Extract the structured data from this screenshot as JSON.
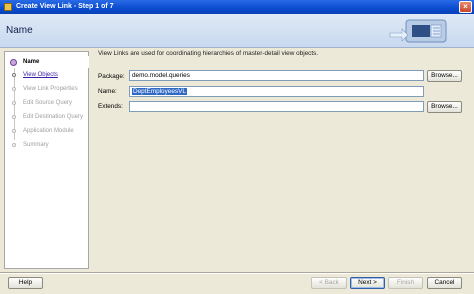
{
  "window": {
    "title": "Create View Link - Step 1 of 7",
    "close_label": "×"
  },
  "header": {
    "title": "Name"
  },
  "nav": {
    "items": [
      {
        "label": "Name",
        "state": "active"
      },
      {
        "label": "View Objects",
        "state": "link"
      },
      {
        "label": "View Link Properties",
        "state": "disabled"
      },
      {
        "label": "Edit Source Query",
        "state": "disabled"
      },
      {
        "label": "Edit Destination Query",
        "state": "disabled"
      },
      {
        "label": "Application Module",
        "state": "disabled"
      },
      {
        "label": "Summary",
        "state": "disabled"
      }
    ]
  },
  "main": {
    "description": "View Links are used for coordinating hierarchies of master-detail view objects.",
    "package_label": "Package:",
    "package_value": "demo.model.queries",
    "name_label": "Name:",
    "name_value": "DeptEmployeesVL",
    "extends_label": "Extends:",
    "extends_value": "",
    "browse_label": "Browse..."
  },
  "footer": {
    "help_label": "Help",
    "back_label": "< Back",
    "next_label": "Next >",
    "finish_label": "Finish",
    "cancel_label": "Cancel"
  }
}
